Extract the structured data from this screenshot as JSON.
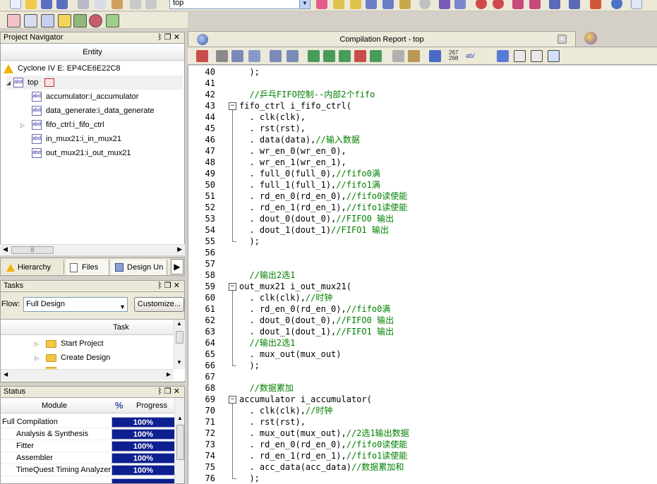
{
  "toolbar": {
    "project_combo_value": "top"
  },
  "navigator": {
    "title": "Project Navigator",
    "entity_header": "Entity",
    "device": "Cyclone IV E: EP4CE6E22C8",
    "top_entity": "top",
    "children": [
      {
        "label": "accumulator:i_accumulator",
        "expandable": false
      },
      {
        "label": "data_generate:i_data_generate",
        "expandable": false
      },
      {
        "label": "fifo_ctrl:i_fifo_ctrl",
        "expandable": true
      },
      {
        "label": "in_mux21:i_in_mux21",
        "expandable": false
      },
      {
        "label": "out_mux21:i_out_mux21",
        "expandable": false
      }
    ],
    "tabs": [
      {
        "label": "Hierarchy"
      },
      {
        "label": "Files"
      },
      {
        "label": "Design Un"
      }
    ]
  },
  "tasks": {
    "title": "Tasks",
    "flow_label": "Flow:",
    "flow_value": "Full Design",
    "customize_label": "Customize...",
    "task_header": "Task",
    "items": [
      {
        "label": "Start Project"
      },
      {
        "label": "Create Design"
      }
    ]
  },
  "status": {
    "title": "Status",
    "module_header": "Module",
    "pct_header": "%",
    "progress_header": "Progress",
    "rows": [
      {
        "module": "Full Compilation",
        "progress": "100%",
        "indent": false
      },
      {
        "module": "Analysis & Synthesis",
        "progress": "100%",
        "indent": true
      },
      {
        "module": "Fitter",
        "progress": "100%",
        "indent": true
      },
      {
        "module": "Assembler",
        "progress": "100%",
        "indent": true
      },
      {
        "module": "TimeQuest Timing Analyzer",
        "progress": "100%",
        "indent": true
      }
    ]
  },
  "report_tab": {
    "title": "Compilation Report - top"
  },
  "editor_toolbar": {
    "numbers_label_top": "267",
    "numbers_label_bottom": "268",
    "ab_label": "ab/"
  },
  "editor": {
    "lines": [
      {
        "n": "40",
        "code": "  );",
        "comment": ""
      },
      {
        "n": "41",
        "code": "",
        "comment": ""
      },
      {
        "n": "42",
        "code": "  ",
        "comment": "//乒乓FIFO控制--内部2个fifo"
      },
      {
        "n": "43",
        "code": "fifo_ctrl i_fifo_ctrl(",
        "comment": ""
      },
      {
        "n": "44",
        "code": "  . clk(clk),",
        "comment": ""
      },
      {
        "n": "45",
        "code": "  . rst(rst),",
        "comment": ""
      },
      {
        "n": "46",
        "code": "  . data(data),",
        "comment": "//输入数据"
      },
      {
        "n": "47",
        "code": "  . wr_en_0(wr_en_0),",
        "comment": ""
      },
      {
        "n": "48",
        "code": "  . wr_en_1(wr_en_1),",
        "comment": ""
      },
      {
        "n": "49",
        "code": "  . full_0(full_0),",
        "comment": "//fifo0满"
      },
      {
        "n": "50",
        "code": "  . full_1(full_1),",
        "comment": "//fifo1满"
      },
      {
        "n": "51",
        "code": "  . rd_en_0(rd_en_0),",
        "comment": "//fifo0读使能"
      },
      {
        "n": "52",
        "code": "  . rd_en_1(rd_en_1),",
        "comment": "//fifo1读使能"
      },
      {
        "n": "53",
        "code": "  . dout_0(dout_0),",
        "comment": "//FIFO0 输出"
      },
      {
        "n": "54",
        "code": "  . dout_1(dout_1)",
        "comment": "//FIFO1 输出"
      },
      {
        "n": "55",
        "code": "  );",
        "comment": ""
      },
      {
        "n": "56",
        "code": "",
        "comment": ""
      },
      {
        "n": "57",
        "code": "",
        "comment": ""
      },
      {
        "n": "58",
        "code": "  ",
        "comment": "//输出2选1"
      },
      {
        "n": "59",
        "code": "out_mux21 i_out_mux21(",
        "comment": ""
      },
      {
        "n": "60",
        "code": "  . clk(clk),",
        "comment": "//时钟"
      },
      {
        "n": "61",
        "code": "  . rd_en_0(rd_en_0),",
        "comment": "//fifo0满"
      },
      {
        "n": "62",
        "code": "  . dout_0(dout_0),",
        "comment": "//FIFO0 输出"
      },
      {
        "n": "63",
        "code": "  . dout_1(dout_1),",
        "comment": "//FIFO1 输出"
      },
      {
        "n": "64",
        "code": "  ",
        "comment": "//输出2选1"
      },
      {
        "n": "65",
        "code": "  . mux_out(mux_out)",
        "comment": ""
      },
      {
        "n": "66",
        "code": "  );",
        "comment": ""
      },
      {
        "n": "67",
        "code": "",
        "comment": ""
      },
      {
        "n": "68",
        "code": "  ",
        "comment": "//数据累加"
      },
      {
        "n": "69",
        "code": "accumulator i_accumulator(",
        "comment": ""
      },
      {
        "n": "70",
        "code": "  . clk(clk),",
        "comment": "//时钟"
      },
      {
        "n": "71",
        "code": "  . rst(rst),",
        "comment": ""
      },
      {
        "n": "72",
        "code": "  . mux_out(mux_out),",
        "comment": "//2选1输出数据"
      },
      {
        "n": "73",
        "code": "  . rd_en_0(rd_en_0),",
        "comment": "//fifo0读使能"
      },
      {
        "n": "74",
        "code": "  . rd_en_1(rd_en_1),",
        "comment": "//fifo1读使能"
      },
      {
        "n": "75",
        "code": "  . acc_data(acc_data)",
        "comment": "//数据累加和"
      },
      {
        "n": "76",
        "code": "  );",
        "comment": ""
      }
    ]
  }
}
